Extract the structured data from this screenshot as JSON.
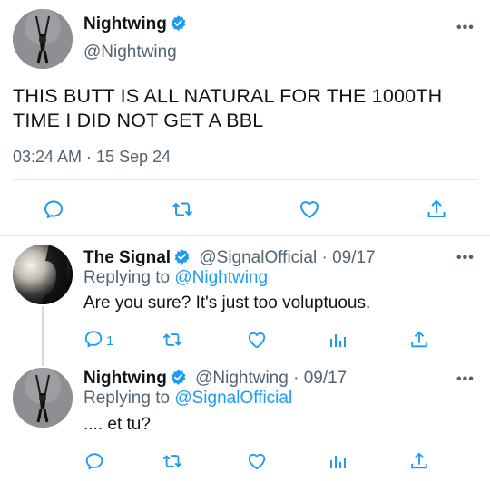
{
  "main_tweet": {
    "display_name": "Nightwing",
    "handle": "@Nightwing",
    "text_line1": "THIS BUTT IS ALL NATURAL FOR THE 1000TH",
    "text_line2": "TIME I DID NOT GET A BBL",
    "timestamp": "03:24 AM · 15 Sep 24",
    "more": "•••"
  },
  "reply1": {
    "display_name": "The Signal",
    "handle_date": "@SignalOfficial · 09/17",
    "replying_prefix": "Replying to ",
    "replying_handle": "@Nightwing",
    "text": "Are you sure? It's just too voluptuous.",
    "reply_count": "1",
    "more": "•••"
  },
  "reply2": {
    "display_name": "Nightwing",
    "handle_date": "@Nightwing · 09/17",
    "replying_prefix": "Replying to ",
    "replying_handle": "@SignalOfficial",
    "text": ".... et tu?",
    "more": "•••"
  },
  "colors": {
    "accent": "#1d9bf0",
    "text": "#0f1419",
    "muted": "#536471",
    "divider": "#e6e9eb"
  },
  "icons": [
    "comment-icon",
    "retweet-icon",
    "like-icon",
    "share-icon",
    "analytics-icon",
    "verified-badge-icon",
    "more-icon"
  ]
}
